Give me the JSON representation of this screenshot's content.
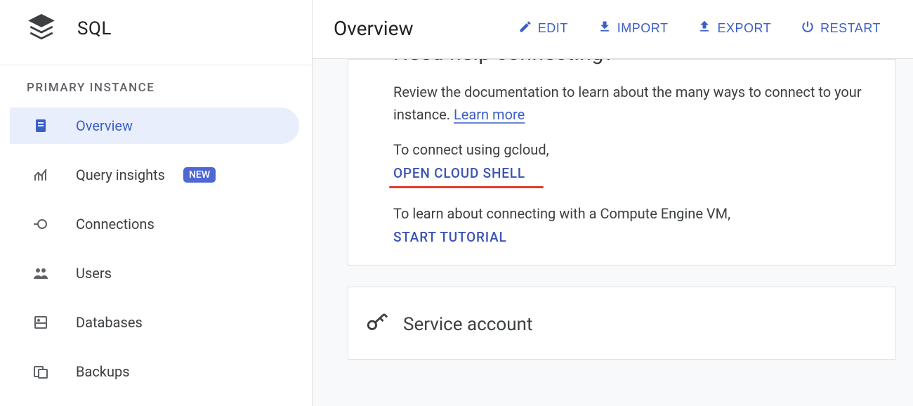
{
  "product_title": "SQL",
  "sidebar": {
    "section_label": "PRIMARY INSTANCE",
    "items": [
      {
        "label": "Overview",
        "icon": "page-icon",
        "active": true
      },
      {
        "label": "Query insights",
        "icon": "chart-icon",
        "badge": "NEW"
      },
      {
        "label": "Connections",
        "icon": "plug-icon"
      },
      {
        "label": "Users",
        "icon": "users-icon"
      },
      {
        "label": "Databases",
        "icon": "database-icon"
      },
      {
        "label": "Backups",
        "icon": "backup-icon"
      }
    ]
  },
  "toolbar": {
    "title": "Overview",
    "actions": {
      "edit": "EDIT",
      "import": "IMPORT",
      "export": "EXPORT",
      "restart": "RESTART"
    }
  },
  "help_card": {
    "heading": "Need help connecting?",
    "review_text_a": "Review the documentation to learn about the many ways to connect to your instance.",
    "learn_more": "Learn more",
    "gcloud_text": "To connect using gcloud,",
    "open_cloud_shell": "OPEN CLOUD SHELL",
    "vm_text": "To learn about connecting with a Compute Engine VM,",
    "start_tutorial": "START TUTORIAL"
  },
  "service_account_card": {
    "title": "Service account"
  }
}
